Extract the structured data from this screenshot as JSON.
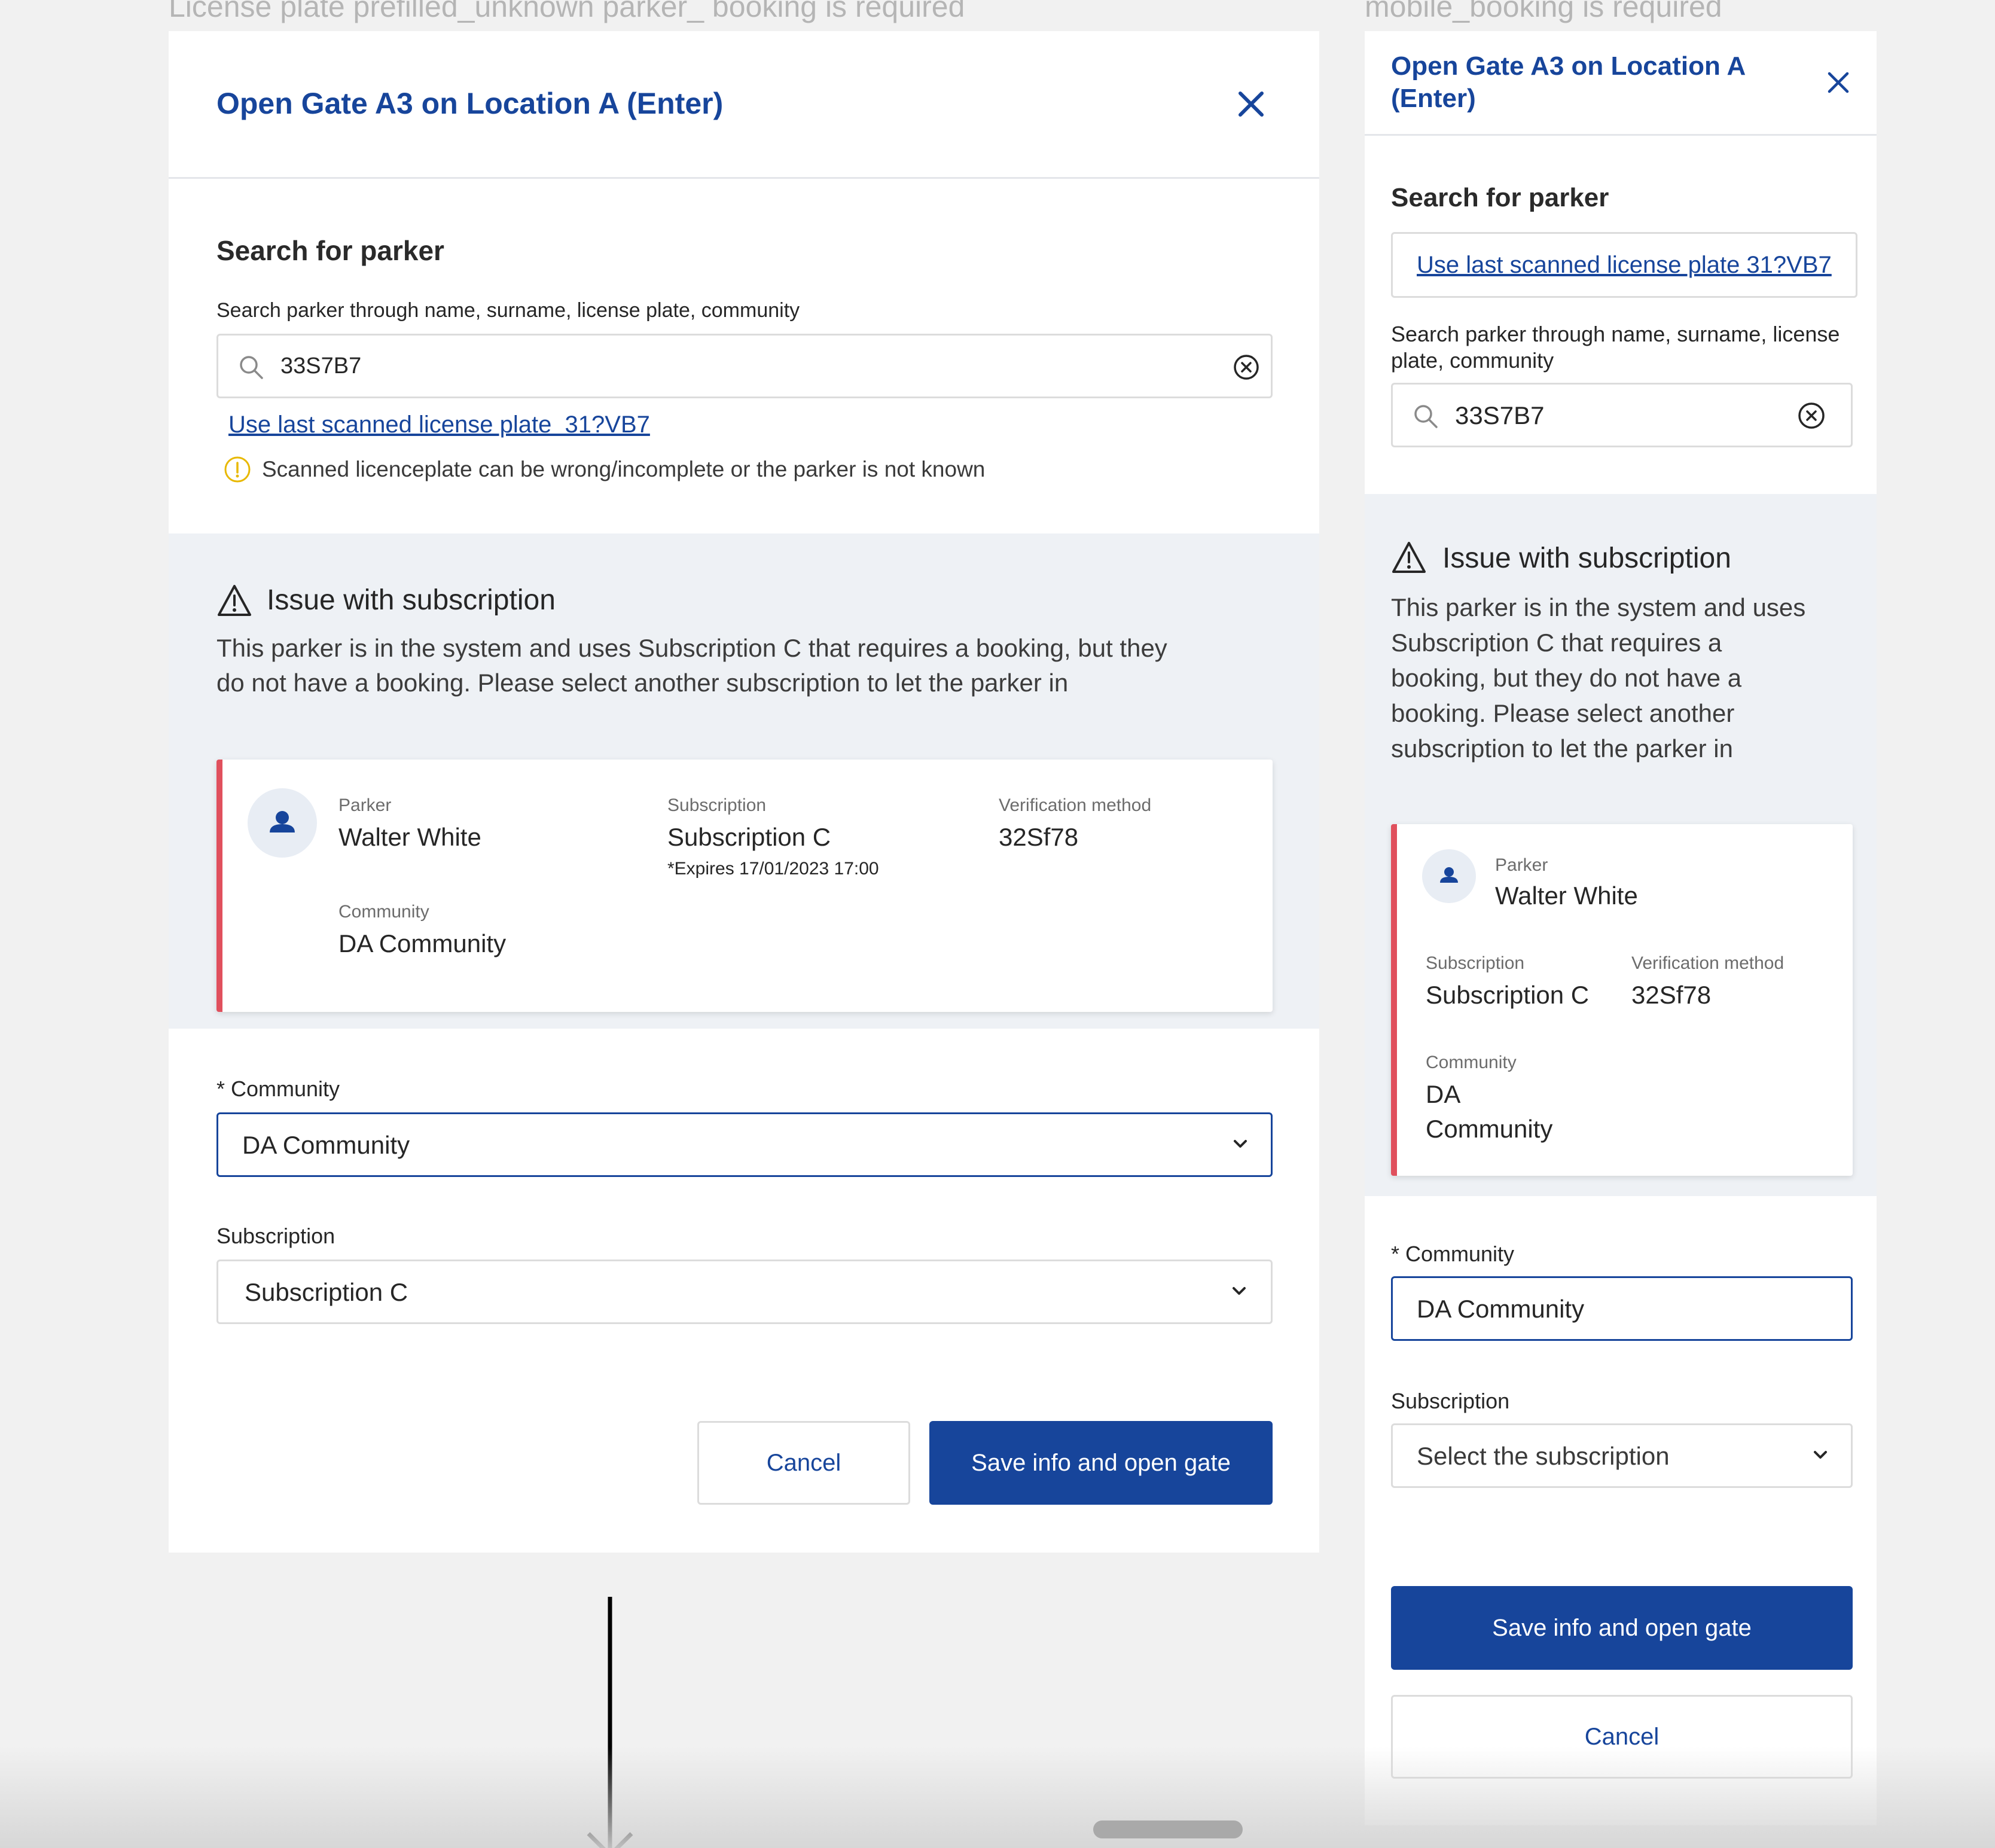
{
  "captions": {
    "left": "License plate prefilled_unknown parker_ booking is required",
    "right": "mobile_booking is required"
  },
  "modal": {
    "title": "Open Gate A3 on Location A (Enter)",
    "title_line1": "Open Gate A3 on Location A",
    "title_line2": "(Enter)",
    "search_heading": "Search for parker",
    "search_label": "Search parker through name, surname, license plate, community",
    "search_label_line1": "Search parker through name, surname, license",
    "search_label_line2": "plate, community",
    "search_value": "33S7B7",
    "last_plate_link": "Use last scanned license plate  31?VB7",
    "last_plate_link_mobile": "Use last scanned license plate 31?VB7",
    "info_text": "Scanned licenceplate can be wrong/incomplete or the parker is not known",
    "issue": {
      "title": "Issue with subscription",
      "text_line1": "This parker is in the system and uses Subscription C that requires a booking, but they",
      "text_line2": "do not have a booking. Please select another subscription to let the parker in",
      "mobile_lines": [
        "This parker is in the system and uses",
        "Subscription C that requires a",
        "booking, but they do not have a",
        "booking. Please select another",
        "subscription to let the parker in"
      ]
    },
    "card": {
      "parker_label": "Parker",
      "parker_value": "Walter White",
      "subscription_label": "Subscription",
      "subscription_value": "Subscription C",
      "expires": "*Expires 17/01/2023 17:00",
      "verification_label": "Verification method",
      "verification_value": "32Sf78",
      "community_label": "Community",
      "community_value": "DA Community",
      "community_value_line1": "DA",
      "community_value_line2": "Community"
    },
    "community_field_label": "* Community",
    "community_selected": "DA Community",
    "subscription_field_label": "Subscription",
    "subscription_selected": "Subscription C",
    "subscription_placeholder": "Select the subscription",
    "cancel_label": "Cancel",
    "save_label": "Save info and open gate"
  },
  "colors": {
    "primary": "#17459b",
    "issue_bg": "#eef1f5",
    "error_border": "#e0505d",
    "info_icon": "#e8b800"
  }
}
